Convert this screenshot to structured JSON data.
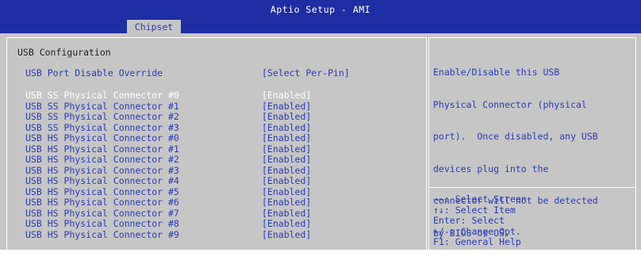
{
  "window": {
    "title": "Aptio Setup - AMI",
    "active_tab": "Chipset"
  },
  "main": {
    "section_title": "USB Configuration",
    "override": {
      "label": "USB Port Disable Override",
      "value": "[Select Per-Pin]"
    },
    "connectors": [
      {
        "label": "USB SS Physical Connector #0",
        "value": "[Enabled]",
        "selected": true
      },
      {
        "label": "USB SS Physical Connector #1",
        "value": "[Enabled]"
      },
      {
        "label": "USB SS Physical Connector #2",
        "value": "[Enabled]"
      },
      {
        "label": "USB SS Physical Connector #3",
        "value": "[Enabled]"
      },
      {
        "label": "USB HS Physical Connector #0",
        "value": "[Enabled]"
      },
      {
        "label": "USB HS Physical Connector #1",
        "value": "[Enabled]"
      },
      {
        "label": "USB HS Physical Connector #2",
        "value": "[Enabled]"
      },
      {
        "label": "USB HS Physical Connector #3",
        "value": "[Enabled]"
      },
      {
        "label": "USB HS Physical Connector #4",
        "value": "[Enabled]"
      },
      {
        "label": "USB HS Physical Connector #5",
        "value": "[Enabled]"
      },
      {
        "label": "USB HS Physical Connector #6",
        "value": "[Enabled]"
      },
      {
        "label": "USB HS Physical Connector #7",
        "value": "[Enabled]"
      },
      {
        "label": "USB HS Physical Connector #8",
        "value": "[Enabled]"
      },
      {
        "label": "USB HS Physical Connector #9",
        "value": "[Enabled]"
      }
    ]
  },
  "help": {
    "lines": [
      "Enable/Disable this USB",
      "Physical Connector (physical",
      "port).  Once disabled, any USB",
      "devices plug into the",
      "connector will not be detected",
      "by BIOS or OS."
    ]
  },
  "keys": [
    {
      "key": "→←",
      "desc": ": Select Screen"
    },
    {
      "key": "↑↓",
      "desc": ": Select Item"
    },
    {
      "key": "Enter",
      "desc": ": Select"
    },
    {
      "key": "+/-",
      "desc": ": Change Opt."
    },
    {
      "key": "F1",
      "desc": ": General Help"
    }
  ],
  "colors": {
    "title_bar": "#1f2da2",
    "background": "#c6c6c6",
    "text_blue": "#2a3bb8",
    "selected_text": "#ffffff",
    "heading_text": "#202020"
  }
}
